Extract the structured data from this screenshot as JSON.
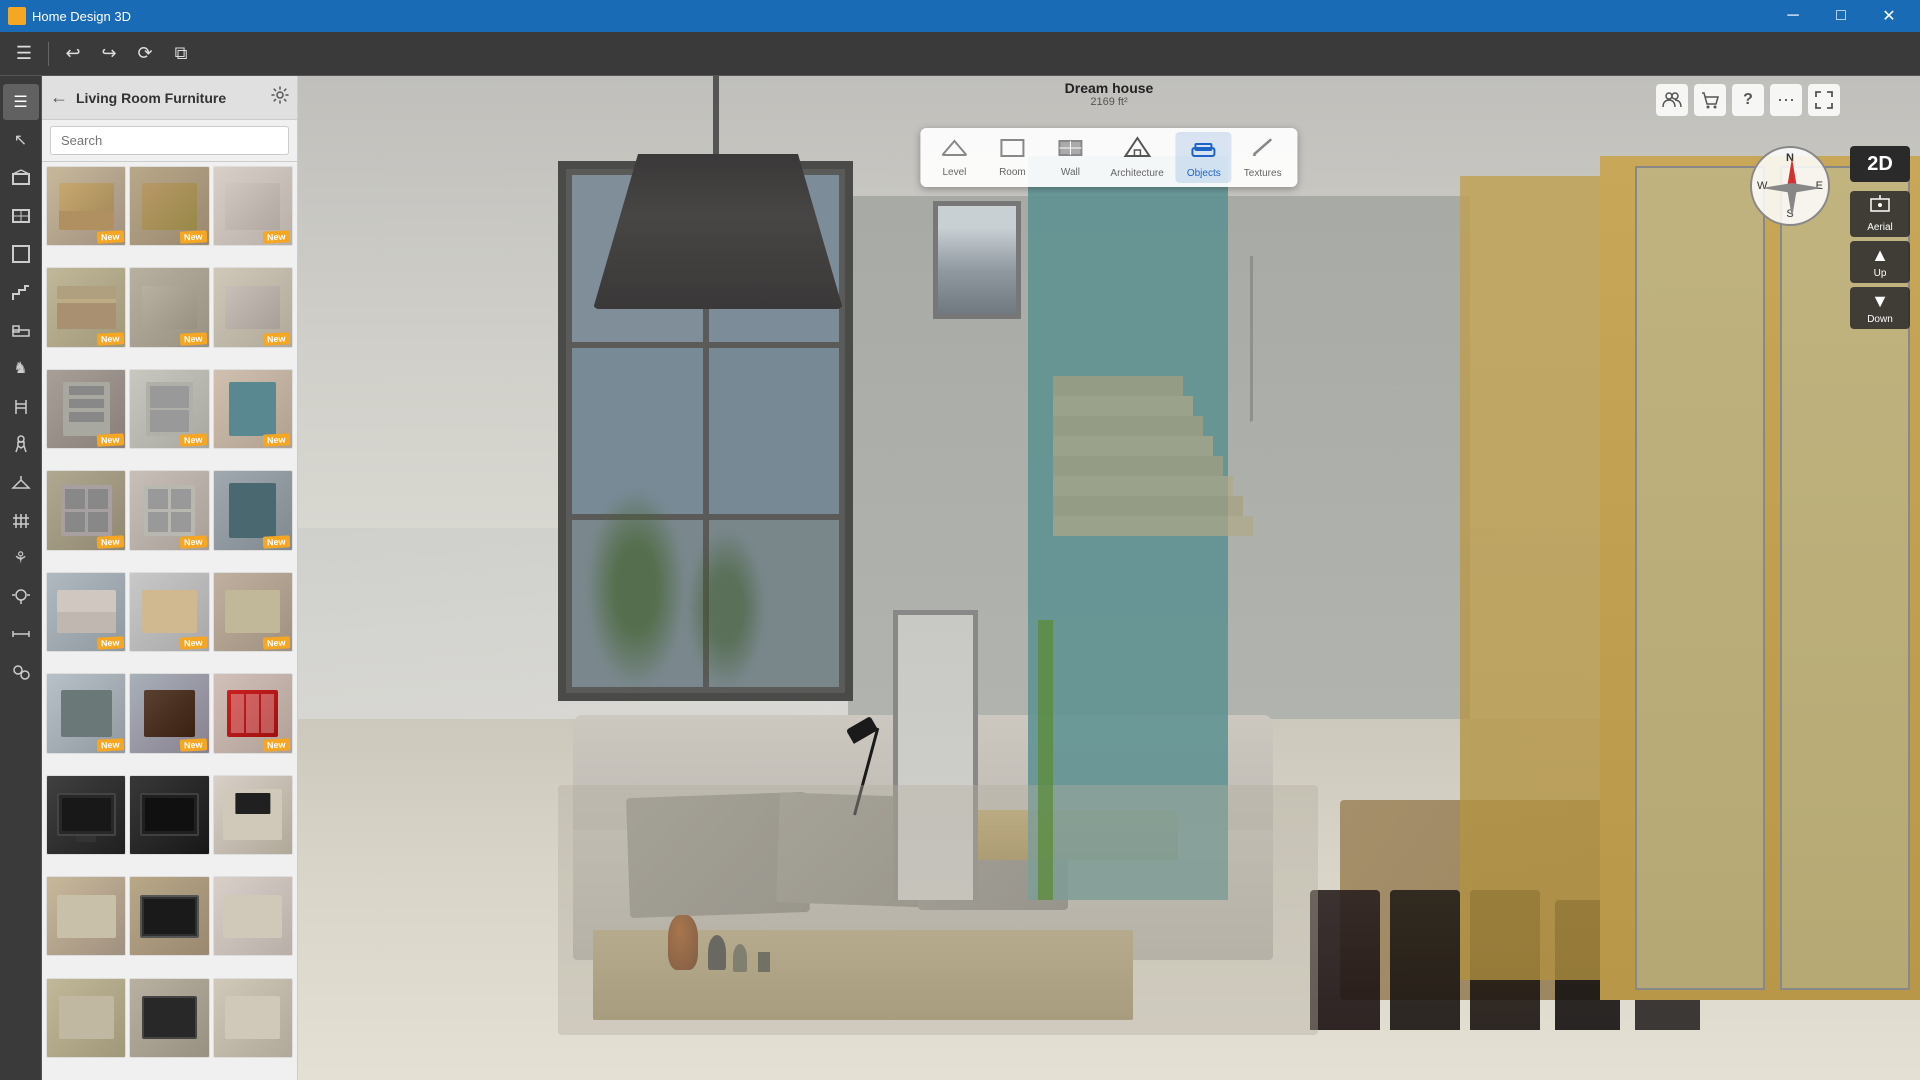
{
  "app": {
    "title": "Home Design 3D",
    "project_name": "Dream house",
    "project_size": "2169 ft²"
  },
  "titlebar": {
    "min_label": "─",
    "max_label": "□",
    "close_label": "✕"
  },
  "toolbar": {
    "menu_icon": "☰",
    "undo_icon": "↩",
    "redo_icon": "↪",
    "refresh_icon": "⟳",
    "copy_icon": "⧉"
  },
  "left_sidebar": {
    "icons": [
      {
        "name": "menu-icon",
        "symbol": "☰"
      },
      {
        "name": "cursor-icon",
        "symbol": "↖"
      },
      {
        "name": "floor-icon",
        "symbol": "▭"
      },
      {
        "name": "wall-icon",
        "symbol": "▬"
      },
      {
        "name": "room-icon",
        "symbol": "⬜"
      },
      {
        "name": "stairs-icon",
        "symbol": "⊟"
      },
      {
        "name": "bed-icon",
        "symbol": "🛏"
      },
      {
        "name": "horse-icon",
        "symbol": "♞"
      },
      {
        "name": "chair-icon",
        "symbol": "🪑"
      },
      {
        "name": "person-icon",
        "symbol": "♟"
      },
      {
        "name": "hanger-icon",
        "symbol": "⊓"
      },
      {
        "name": "fence-icon",
        "symbol": "⊞"
      },
      {
        "name": "plant-icon",
        "symbol": "⚘"
      },
      {
        "name": "light-icon",
        "symbol": "💡"
      },
      {
        "name": "measure-icon",
        "symbol": "📐"
      },
      {
        "name": "group-icon",
        "symbol": "⊕"
      }
    ]
  },
  "panel": {
    "title": "Living Room Furniture",
    "search_placeholder": "Search",
    "back_icon": "←",
    "settings_icon": "⚙"
  },
  "furniture_grid": {
    "items": [
      {
        "id": 1,
        "style": "fi-1",
        "new": true
      },
      {
        "id": 2,
        "style": "fi-2",
        "new": true
      },
      {
        "id": 3,
        "style": "fi-3",
        "new": true
      },
      {
        "id": 4,
        "style": "fi-4",
        "new": true
      },
      {
        "id": 5,
        "style": "fi-5",
        "new": true
      },
      {
        "id": 6,
        "style": "fi-6",
        "new": true
      },
      {
        "id": 7,
        "style": "fi-7",
        "new": true
      },
      {
        "id": 8,
        "style": "fi-8",
        "new": true
      },
      {
        "id": 9,
        "style": "fi-9",
        "new": true
      },
      {
        "id": 10,
        "style": "fi-10",
        "new": true
      },
      {
        "id": 11,
        "style": "fi-11",
        "new": true
      },
      {
        "id": 12,
        "style": "fi-12",
        "new": true
      },
      {
        "id": 13,
        "style": "fi-13",
        "new": true
      },
      {
        "id": 14,
        "style": "fi-14",
        "new": true
      },
      {
        "id": 15,
        "style": "fi-15",
        "new": true
      },
      {
        "id": 16,
        "style": "fi-16",
        "new": true
      },
      {
        "id": 17,
        "style": "fi-17",
        "new": true
      },
      {
        "id": 18,
        "style": "fi-18",
        "new": true
      },
      {
        "id": 19,
        "style": "fi-tv1",
        "new": false
      },
      {
        "id": 20,
        "style": "fi-tv2",
        "new": false
      },
      {
        "id": 21,
        "style": "fi-tv3",
        "new": false
      },
      {
        "id": 22,
        "style": "fi-1",
        "new": false
      },
      {
        "id": 23,
        "style": "fi-2",
        "new": false
      },
      {
        "id": 24,
        "style": "fi-3",
        "new": false
      },
      {
        "id": 25,
        "style": "fi-4",
        "new": false
      },
      {
        "id": 26,
        "style": "fi-5",
        "new": false
      },
      {
        "id": 27,
        "style": "fi-6",
        "new": false
      }
    ],
    "new_label": "New"
  },
  "center_toolbar": {
    "buttons": [
      {
        "id": "level",
        "label": "Level",
        "icon": "▭",
        "active": false
      },
      {
        "id": "room",
        "label": "Room",
        "icon": "⬜",
        "active": false
      },
      {
        "id": "wall",
        "label": "Wall",
        "icon": "▬",
        "active": false
      },
      {
        "id": "architecture",
        "label": "Architecture",
        "icon": "🏠",
        "active": false
      },
      {
        "id": "objects",
        "label": "Objects",
        "icon": "🛋",
        "active": true
      },
      {
        "id": "textures",
        "label": "Textures",
        "icon": "✏",
        "active": false
      }
    ]
  },
  "compass": {
    "n": "N",
    "s": "S",
    "e": "E",
    "w": "W"
  },
  "view_controls": {
    "btn_2d": "2D",
    "aerial_icon": "📷",
    "aerial_label": "Aerial",
    "up_icon": "▲",
    "up_label": "Up",
    "down_icon": "▼",
    "down_label": "Down"
  },
  "top_right_icons": {
    "people_icon": "👥",
    "cart_icon": "🛒",
    "help_icon": "?",
    "more_icon": "⋯",
    "expand_icon": "⛶"
  }
}
